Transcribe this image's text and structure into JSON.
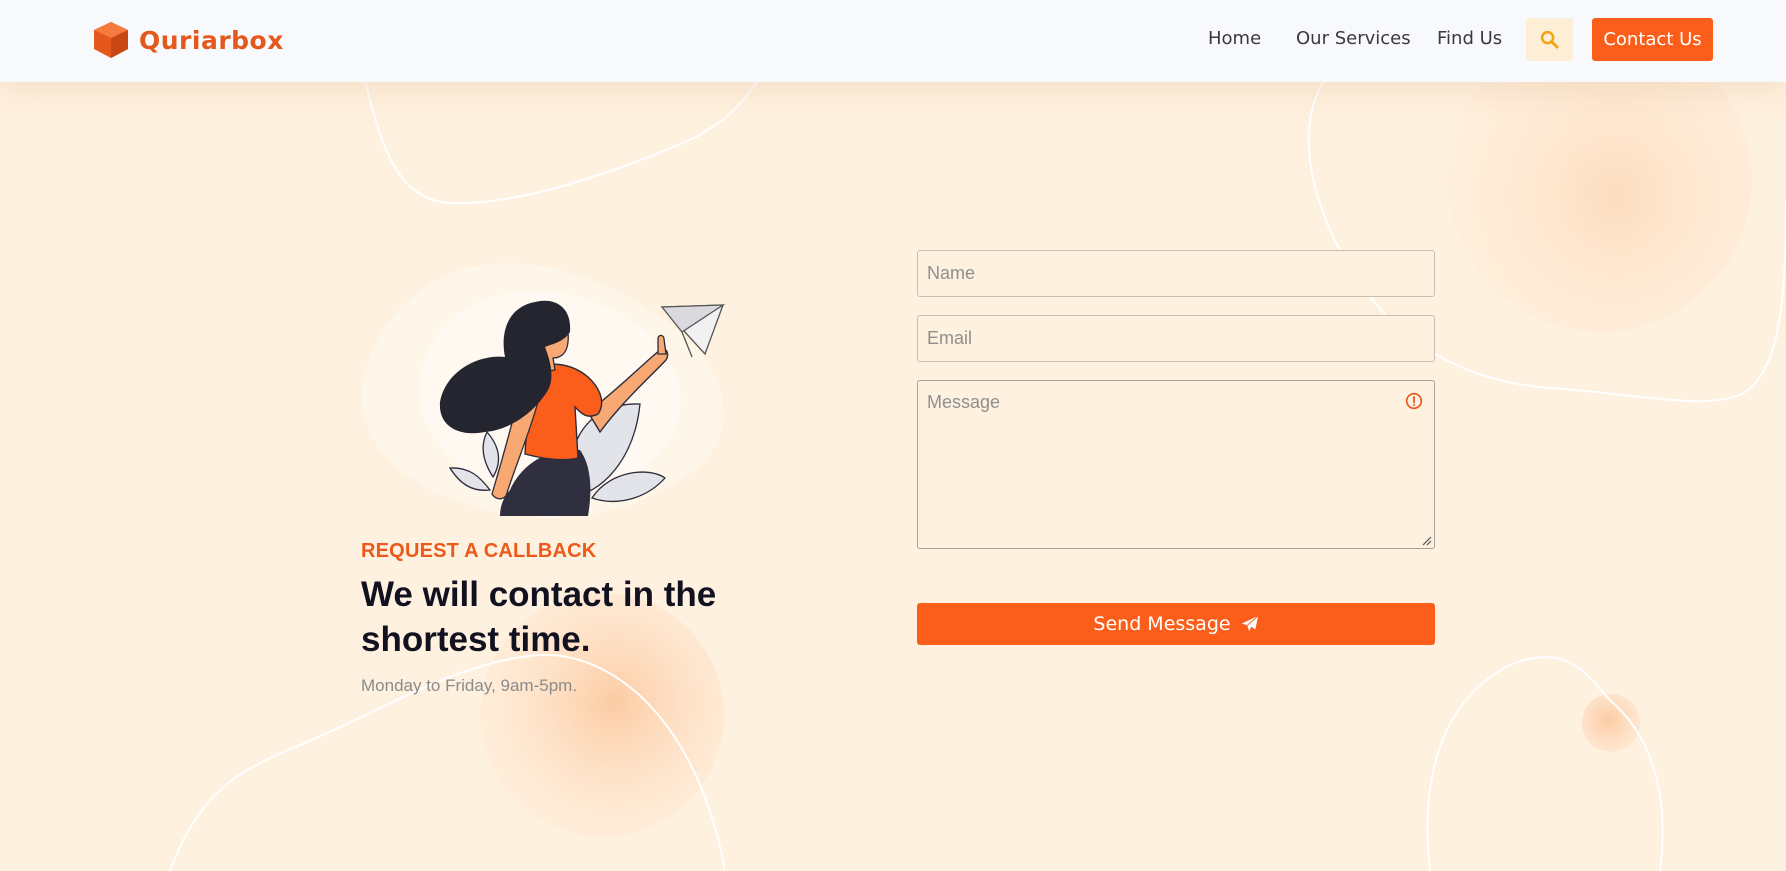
{
  "brand": {
    "name": "Quriarbox",
    "color": "#e4581c"
  },
  "nav": {
    "items": [
      {
        "label": "Home"
      },
      {
        "label": "Our Services"
      },
      {
        "label": "Find Us"
      }
    ],
    "search_icon": "search-icon",
    "contact_label": "Contact Us"
  },
  "callback": {
    "eyebrow": "REQUEST A CALLBACK",
    "headline": "We will contact in the shortest time.",
    "hours": "Monday to Friday, 9am-5pm."
  },
  "form": {
    "name_placeholder": "Name",
    "email_placeholder": "Email",
    "message_placeholder": "Message",
    "send_label": "Send Message",
    "send_icon": "paper-plane-icon",
    "message_status_icon": "warning-icon"
  },
  "colors": {
    "accent": "#fb5e1a",
    "background": "#fff1df",
    "header_bg": "#f7f9fd",
    "heading": "#111120",
    "muted": "#8b8b8b"
  }
}
